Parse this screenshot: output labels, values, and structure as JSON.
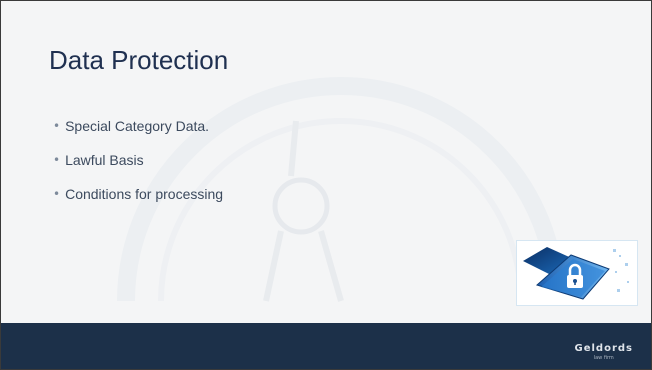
{
  "slide": {
    "title": "Data Protection",
    "bullets": [
      {
        "text": "Special Category Data."
      },
      {
        "text": "Lawful Basis"
      },
      {
        "text": "Conditions for processing"
      }
    ]
  },
  "image": {
    "icon": "padlock-folder-icon"
  },
  "footer": {
    "brand_name": "Geldords",
    "brand_tagline": "law firm"
  },
  "colors": {
    "title": "#1f3050",
    "footer_band": "#1c3049",
    "background": "#f4f5f6"
  }
}
